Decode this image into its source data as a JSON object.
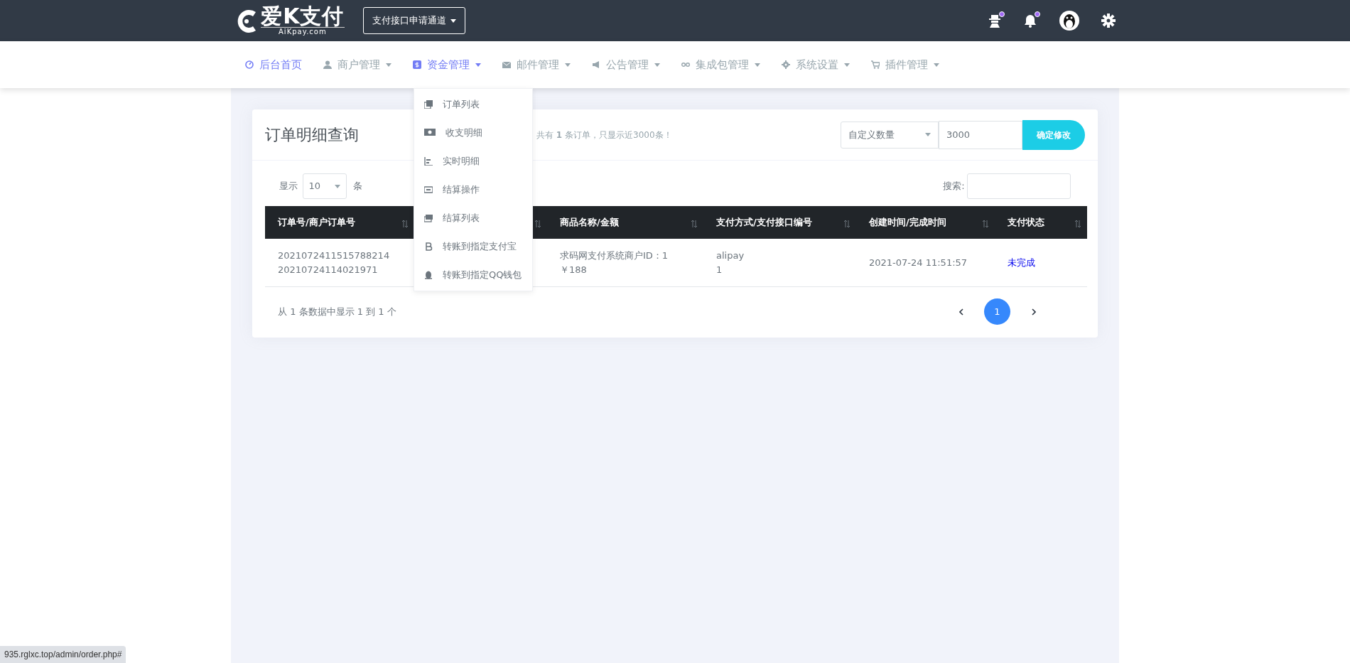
{
  "topbar": {
    "logo": {
      "name": "爱K支付",
      "domain": "AiKpay.com"
    },
    "channel_button": "支付接口申请通道"
  },
  "nav": {
    "items": [
      {
        "label": "后台首页",
        "selected": true,
        "expanded": false,
        "caret": false
      },
      {
        "label": "商户管理",
        "selected": false,
        "expanded": false,
        "caret": true
      },
      {
        "label": "资金管理",
        "selected": true,
        "expanded": true,
        "caret": true,
        "menu": [
          "订单列表",
          "收支明细",
          "实时明细",
          "结算操作",
          "结算列表",
          "转账到指定支付宝",
          "转账到指定QQ钱包"
        ]
      },
      {
        "label": "邮件管理",
        "selected": false,
        "expanded": false,
        "caret": true
      },
      {
        "label": "公告管理",
        "selected": false,
        "expanded": false,
        "caret": true
      },
      {
        "label": "集成包管理",
        "selected": false,
        "expanded": false,
        "caret": true
      },
      {
        "label": "系统设置",
        "selected": false,
        "expanded": false,
        "caret": true
      },
      {
        "label": "插件管理",
        "selected": false,
        "expanded": false,
        "caret": true
      }
    ]
  },
  "card": {
    "title": "订单明细查询",
    "notice": "共有 **1** 条订单，只显示近3000条！",
    "count_select": "自定义数量",
    "count_input": "3000",
    "confirm_button": "确定修改",
    "length": {
      "label": "显示",
      "value": "10",
      "unit": "条"
    },
    "search_label": "搜索:",
    "table": {
      "columns": [
        {
          "label": "订单号/商户订单号",
          "sortable": true
        },
        {
          "sortable": true
        },
        {
          "label": "商品名称/金额",
          "sortable": true
        },
        {
          "label": "支付方式/支付接口编号",
          "sortable": true
        },
        {
          "label": "创建时间/完成时间",
          "sortable": true
        },
        {
          "label": "支付状态",
          "sortable": true
        }
      ],
      "rows": [
        {
          "order": [
            "2021072411515788214",
            "20210724114021971"
          ],
          "product": [
            "求码网支付系统商户ID：1",
            "￥188"
          ],
          "payment": [
            "alipay",
            "1"
          ],
          "time": "2021-07-24 11:51:57",
          "status": "未完成"
        }
      ]
    },
    "info": "从 1 条数据中显示 1 到 1 个",
    "pages": [
      {
        "label": "1",
        "selected": true
      }
    ]
  },
  "status_bar": "935.rglxc.top/admin/order.php#"
}
